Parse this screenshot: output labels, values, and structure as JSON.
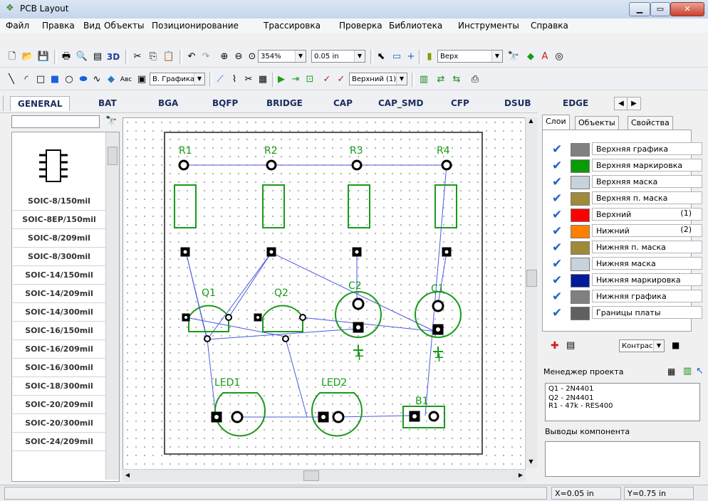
{
  "window": {
    "title": "PCB Layout"
  },
  "menu": [
    "Файл",
    "Правка",
    "Вид",
    "Объекты",
    "Позиционирование",
    "Трассировка",
    "Проверка",
    "Библиотека",
    "Инструменты",
    "Справка"
  ],
  "toolbar1": {
    "label_3d": "3D",
    "zoom": "354%",
    "grid": "0.05 in",
    "layer": "Верх"
  },
  "toolbar2": {
    "abc": "Авс",
    "graphics_layer": "В. Графика",
    "side_layer": "Верхний (1)"
  },
  "library_tabs": [
    "GENERAL",
    "BAT",
    "BGA",
    "BQFP",
    "BRIDGE",
    "CAP",
    "CAP_SMD",
    "CFP",
    "DSUB",
    "EDGE"
  ],
  "components": [
    "SOIC-8/150mil",
    "SOIC-8EP/150mil",
    "SOIC-8/209mil",
    "SOIC-8/300mil",
    "SOIC-14/150mil",
    "SOIC-14/209mil",
    "SOIC-14/300mil",
    "SOIC-16/150mil",
    "SOIC-16/209mil",
    "SOIC-16/300mil",
    "SOIC-18/300mil",
    "SOIC-20/209mil",
    "SOIC-20/300mil",
    "SOIC-24/209mil"
  ],
  "board": {
    "labels": {
      "r1": "R1",
      "r2": "R2",
      "r3": "R3",
      "r4": "R4",
      "q1": "Q1",
      "q2": "Q2",
      "c2": "C2",
      "c1": "C1",
      "led1": "LED1",
      "led2": "LED2",
      "b1": "B1",
      "plus1": "+",
      "plus2": "+"
    },
    "colors": {
      "silk": "#1a9a1a",
      "ratsnest": "#4a5ae0",
      "pad": "#000000"
    }
  },
  "right_panel": {
    "tabs": [
      "Слои",
      "Объекты",
      "Свойства"
    ],
    "layers": [
      {
        "name": "Верхняя графика",
        "color": "#808080",
        "num": ""
      },
      {
        "name": "Верхняя маркировка",
        "color": "#0a9a0a",
        "num": ""
      },
      {
        "name": "Верхняя маска",
        "color": "#c8d2da",
        "num": ""
      },
      {
        "name": "Верхняя п. маска",
        "color": "#a08a3a",
        "num": ""
      },
      {
        "name": "Верхний",
        "color": "#ff0000",
        "num": "(1)"
      },
      {
        "name": "Нижний",
        "color": "#ff8000",
        "num": "(2)"
      },
      {
        "name": "Нижняя п. маска",
        "color": "#a08a3a",
        "num": ""
      },
      {
        "name": "Нижняя маска",
        "color": "#c8d2da",
        "num": ""
      },
      {
        "name": "Нижняя маркировка",
        "color": "#001a9a",
        "num": ""
      },
      {
        "name": "Нижняя графика",
        "color": "#808080",
        "num": ""
      },
      {
        "name": "Границы платы",
        "color": "#606060",
        "num": ""
      }
    ],
    "contrast_label": "Контраст",
    "project_manager": {
      "title": "Менеджер проекта",
      "items": [
        "Q1 - 2N4401",
        "Q2 - 2N4401",
        "R1 - 47k - RES400"
      ]
    },
    "component_pins": {
      "title": "Выводы компонента"
    }
  },
  "status": {
    "x": "X=0.05 in",
    "y": "Y=0.75 in"
  }
}
